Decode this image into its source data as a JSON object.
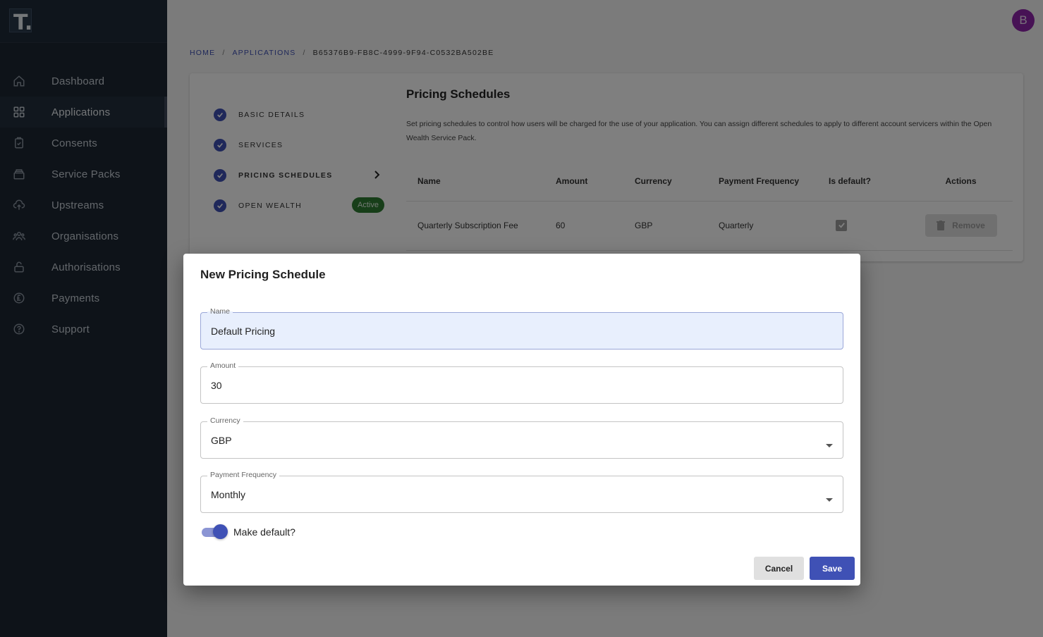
{
  "logo": {
    "letter": "T."
  },
  "sidebar": {
    "items": [
      {
        "label": "Dashboard",
        "icon": "home-icon"
      },
      {
        "label": "Applications",
        "icon": "grid-icon"
      },
      {
        "label": "Consents",
        "icon": "clipboard-check-icon"
      },
      {
        "label": "Service Packs",
        "icon": "stack-icon"
      },
      {
        "label": "Upstreams",
        "icon": "cloud-upload-icon"
      },
      {
        "label": "Organisations",
        "icon": "people-group-icon"
      },
      {
        "label": "Authorisations",
        "icon": "lock-icon"
      },
      {
        "label": "Payments",
        "icon": "pound-coin-icon"
      },
      {
        "label": "Support",
        "icon": "help-circle-icon"
      }
    ],
    "active_index": 1
  },
  "header": {
    "avatar_letter": "B"
  },
  "breadcrumb": {
    "home": "HOME",
    "applications": "APPLICATIONS",
    "current": "B65376B9-FB8C-4999-9F94-C0532BA502BE",
    "separator": "/"
  },
  "steps": [
    {
      "label": "BASIC DETAILS"
    },
    {
      "label": "SERVICES"
    },
    {
      "label": "PRICING SCHEDULES"
    },
    {
      "label": "OPEN WEALTH",
      "badge": "Active"
    }
  ],
  "panel": {
    "title": "Pricing Schedules",
    "description": "Set pricing schedules to control how users will be charged for the use of your application. You can assign different schedules to apply to different account servicers within the Open Wealth Service Pack.",
    "columns": [
      "Name",
      "Amount",
      "Currency",
      "Payment Frequency",
      "Is default?",
      "Actions"
    ],
    "rows": [
      {
        "name": "Quarterly Subscription Fee",
        "amount": "60",
        "currency": "GBP",
        "frequency": "Quarterly",
        "is_default": true,
        "action": "Remove"
      }
    ]
  },
  "dialog": {
    "title": "New Pricing Schedule",
    "fields": {
      "name": {
        "label": "Name",
        "value": "Default Pricing"
      },
      "amount": {
        "label": "Amount",
        "value": "30"
      },
      "currency": {
        "label": "Currency",
        "value": "GBP"
      },
      "frequency": {
        "label": "Payment Frequency",
        "value": "Monthly"
      }
    },
    "toggle": {
      "label": "Make default?",
      "on": true
    },
    "cancel_label": "Cancel",
    "save_label": "Save"
  },
  "colors": {
    "sidebar_bg": "#1c2633",
    "primary": "#3f51b5",
    "active_badge": "#2e7d32",
    "avatar": "#8e24aa"
  }
}
